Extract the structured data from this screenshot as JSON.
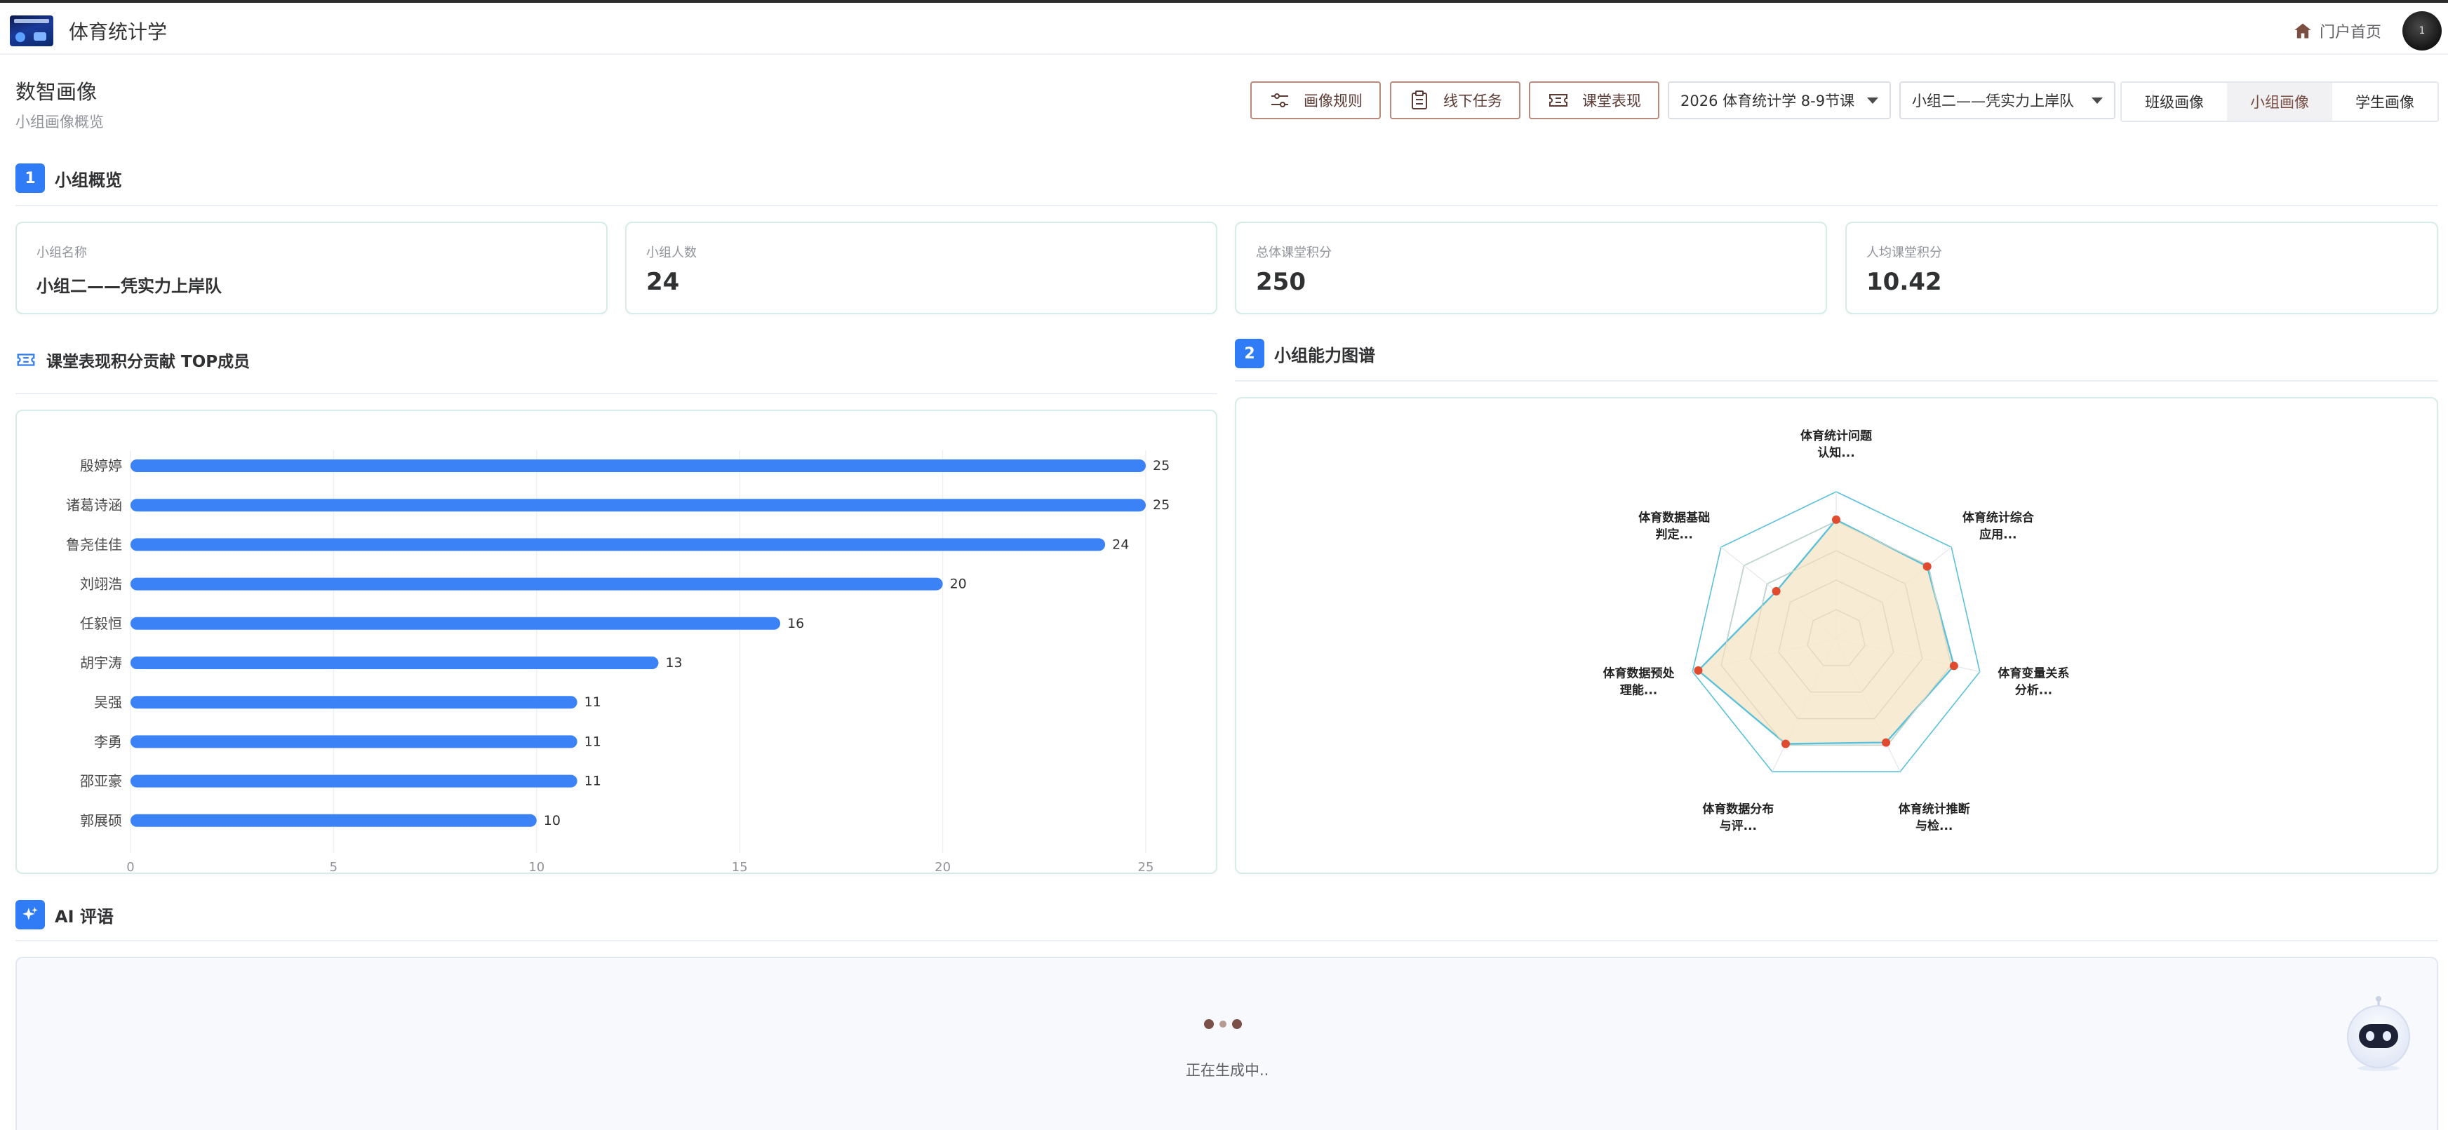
{
  "header": {
    "app_title": "体育统计学",
    "home_link": "门户首页",
    "avatar_initial": "1"
  },
  "page": {
    "title": "数智画像",
    "subtitle": "小组画像概览"
  },
  "toolbar": {
    "rules_button": "画像规则",
    "offline_task_button": "线下任务",
    "class_perf_button": "课堂表现",
    "course_select": "2026 体育统计学 8-9节课",
    "group_select": "小组二——凭实力上岸队",
    "views": [
      {
        "label": "班级画像",
        "active": false
      },
      {
        "label": "小组画像",
        "active": true
      },
      {
        "label": "学生画像",
        "active": false
      }
    ]
  },
  "section1": {
    "number": "1",
    "title": "小组概览",
    "cards": [
      {
        "label": "小组名称",
        "value": "小组二——凭实力上岸队"
      },
      {
        "label": "小组人数",
        "value": "24"
      },
      {
        "label": "总体课堂积分",
        "value": "250"
      },
      {
        "label": "人均课堂积分",
        "value": "10.42"
      }
    ]
  },
  "top_members": {
    "title": "课堂表现积分贡献 TOP成员",
    "icon": "ticket-icon"
  },
  "section2": {
    "number": "2",
    "title": "小组能力图谱"
  },
  "ai": {
    "title": "AI 评语",
    "icon": "sparkle-icon",
    "status": "正在生成中.."
  },
  "colors": {
    "accent": "#2f7cf6",
    "bar": "#3b82f6",
    "brown": "#7a4e43",
    "radar_fill": "#f6e8cc",
    "radar_line": "#5bc0d9",
    "radar_point": "#e04a2f"
  },
  "chart_data": [
    {
      "type": "bar",
      "orientation": "horizontal",
      "categories": [
        "殷婷婷",
        "诸葛诗涵",
        "鲁尧佳佳",
        "刘翊浩",
        "任毅恒",
        "胡宇涛",
        "吴强",
        "李勇",
        "邵亚豪",
        "郭展硕"
      ],
      "values": [
        25,
        25,
        24,
        20,
        16,
        13,
        11,
        11,
        11,
        10
      ],
      "xlim": [
        0,
        25
      ],
      "xticks": [
        "0",
        "5",
        "10",
        "15",
        "20",
        "25"
      ],
      "grid": true
    },
    {
      "type": "radar",
      "axes": [
        "体育统计问题认知...",
        "体育统计综合应用...",
        "体育变量关系分析...",
        "体育统计推断与检...",
        "体育数据分布与评...",
        "体育数据预处理能...",
        "体育数据基础判定..."
      ],
      "axis_labels": [
        [
          "体育统计问题",
          "认知..."
        ],
        [
          "体育统计综合",
          "应用..."
        ],
        [
          "体育变量关系",
          "分析..."
        ],
        [
          "体育统计推断",
          "与检..."
        ],
        [
          "体育数据分布",
          "与评..."
        ],
        [
          "体育数据预处",
          "理能..."
        ],
        [
          "体育数据基础",
          "判定..."
        ]
      ],
      "values": [
        0.81,
        0.79,
        0.82,
        0.78,
        0.79,
        0.96,
        0.52
      ],
      "max": 1,
      "rings": 5
    }
  ]
}
